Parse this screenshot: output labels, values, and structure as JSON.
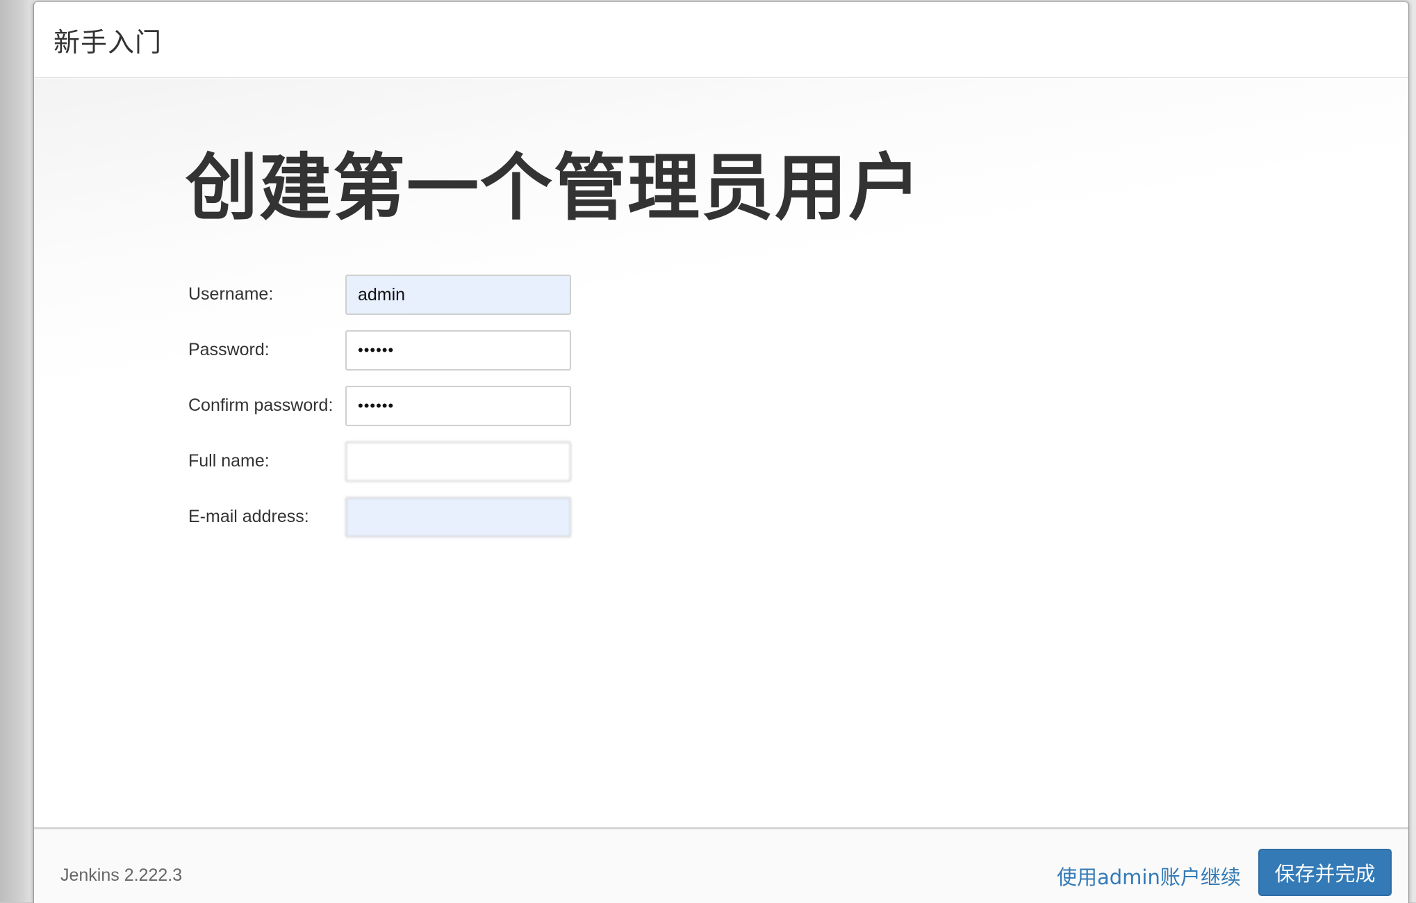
{
  "header": {
    "title": "新手入门"
  },
  "main": {
    "title": "创建第一个管理员用户",
    "fields": [
      {
        "label": "Username:",
        "value": "admin",
        "type": "text"
      },
      {
        "label": "Password:",
        "value": "••••••",
        "type": "password"
      },
      {
        "label": "Confirm password:",
        "value": "••••••",
        "type": "password"
      },
      {
        "label": "Full name:",
        "value": "",
        "type": "text"
      },
      {
        "label": "E-mail address:",
        "value": "",
        "type": "email"
      }
    ]
  },
  "footer": {
    "version": "Jenkins 2.222.3",
    "continue_link": "使用admin账户继续",
    "save_button": "保存并完成"
  },
  "colors": {
    "accent": "#337ab7",
    "autofill_bg": "#e8f0fe",
    "text": "#333333"
  }
}
